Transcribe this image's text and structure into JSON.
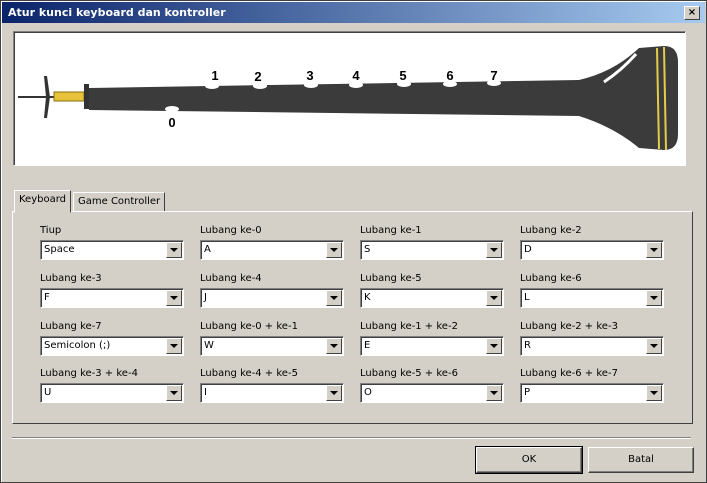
{
  "window": {
    "title": "Atur kunci keyboard dan kontroller",
    "close_label": "×"
  },
  "instrument": {
    "holes": [
      "0",
      "1",
      "2",
      "3",
      "4",
      "5",
      "6",
      "7"
    ]
  },
  "tabs": [
    {
      "label": "Keyboard",
      "active": true
    },
    {
      "label": "Game Controller",
      "active": false
    }
  ],
  "fields": [
    {
      "label": "Tiup",
      "value": "Space"
    },
    {
      "label": "Lubang ke-0",
      "value": "A"
    },
    {
      "label": "Lubang ke-1",
      "value": "S"
    },
    {
      "label": "Lubang ke-2",
      "value": "D"
    },
    {
      "label": "Lubang ke-3",
      "value": "F"
    },
    {
      "label": "Lubang ke-4",
      "value": "J"
    },
    {
      "label": "Lubang ke-5",
      "value": "K"
    },
    {
      "label": "Lubang ke-6",
      "value": "L"
    },
    {
      "label": "Lubang ke-7",
      "value": "Semicolon (;)"
    },
    {
      "label": "Lubang ke-0 + ke-1",
      "value": "W"
    },
    {
      "label": "Lubang ke-1 + ke-2",
      "value": "E"
    },
    {
      "label": "Lubang ke-2 + ke-3",
      "value": "R"
    },
    {
      "label": "Lubang ke-3 + ke-4",
      "value": "U"
    },
    {
      "label": "Lubang ke-4 + ke-5",
      "value": "I"
    },
    {
      "label": "Lubang ke-5 + ke-6",
      "value": "O"
    },
    {
      "label": "Lubang ke-6 + ke-7",
      "value": "P"
    }
  ],
  "buttons": {
    "ok": "OK",
    "cancel": "Batal"
  }
}
